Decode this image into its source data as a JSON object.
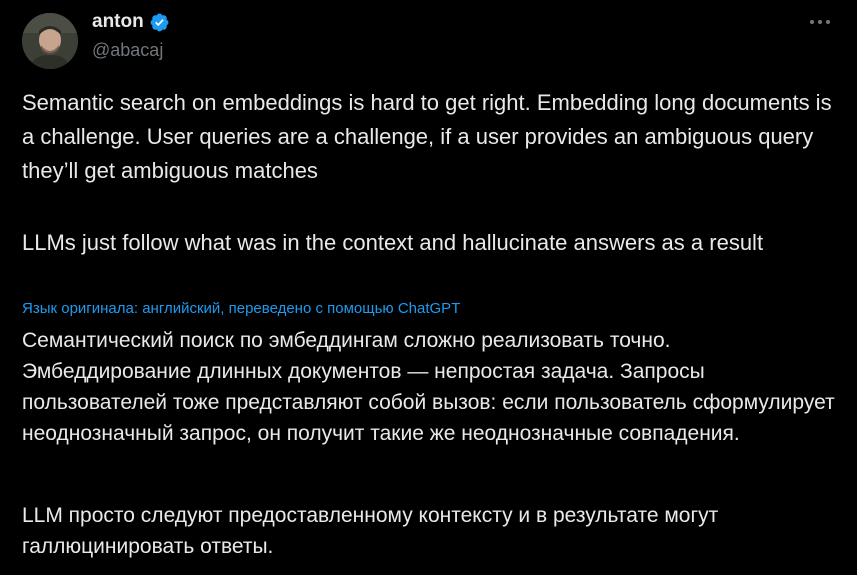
{
  "author": {
    "display_name": "anton",
    "handle": "@abacaj",
    "verified": true,
    "avatar_icon": "person-avatar"
  },
  "menu": {
    "more_icon": "more-horizontal-icon"
  },
  "tweet": {
    "paragraphs": [
      "Semantic search on embeddings is hard to get right. Embedding long documents is a challenge. User queries are a challenge, if a user provides an ambiguous query they’ll get ambiguous matches",
      "LLMs just follow what was in the context and hallucinate answers as a result"
    ]
  },
  "translation": {
    "note": "Язык оригинала: английский, переведено с помощью ChatGPT",
    "paragraphs": [
      "Семантический поиск по эмбеддингам сложно реализовать точно. Эмбеддирование длинных документов — непростая задача. Запросы пользователей тоже представляют собой вызов: если пользователь сформулирует неоднозначный запрос, он получит такие же неоднозначные совпадения.",
      "LLM просто следуют предоставленному контексту и в результате могут галлюцинировать ответы."
    ]
  },
  "colors": {
    "background": "#000000",
    "text": "#e7e9ea",
    "secondary_text": "#71767b",
    "link": "#1d9bf0",
    "verified_badge": "#1d9bf0"
  }
}
